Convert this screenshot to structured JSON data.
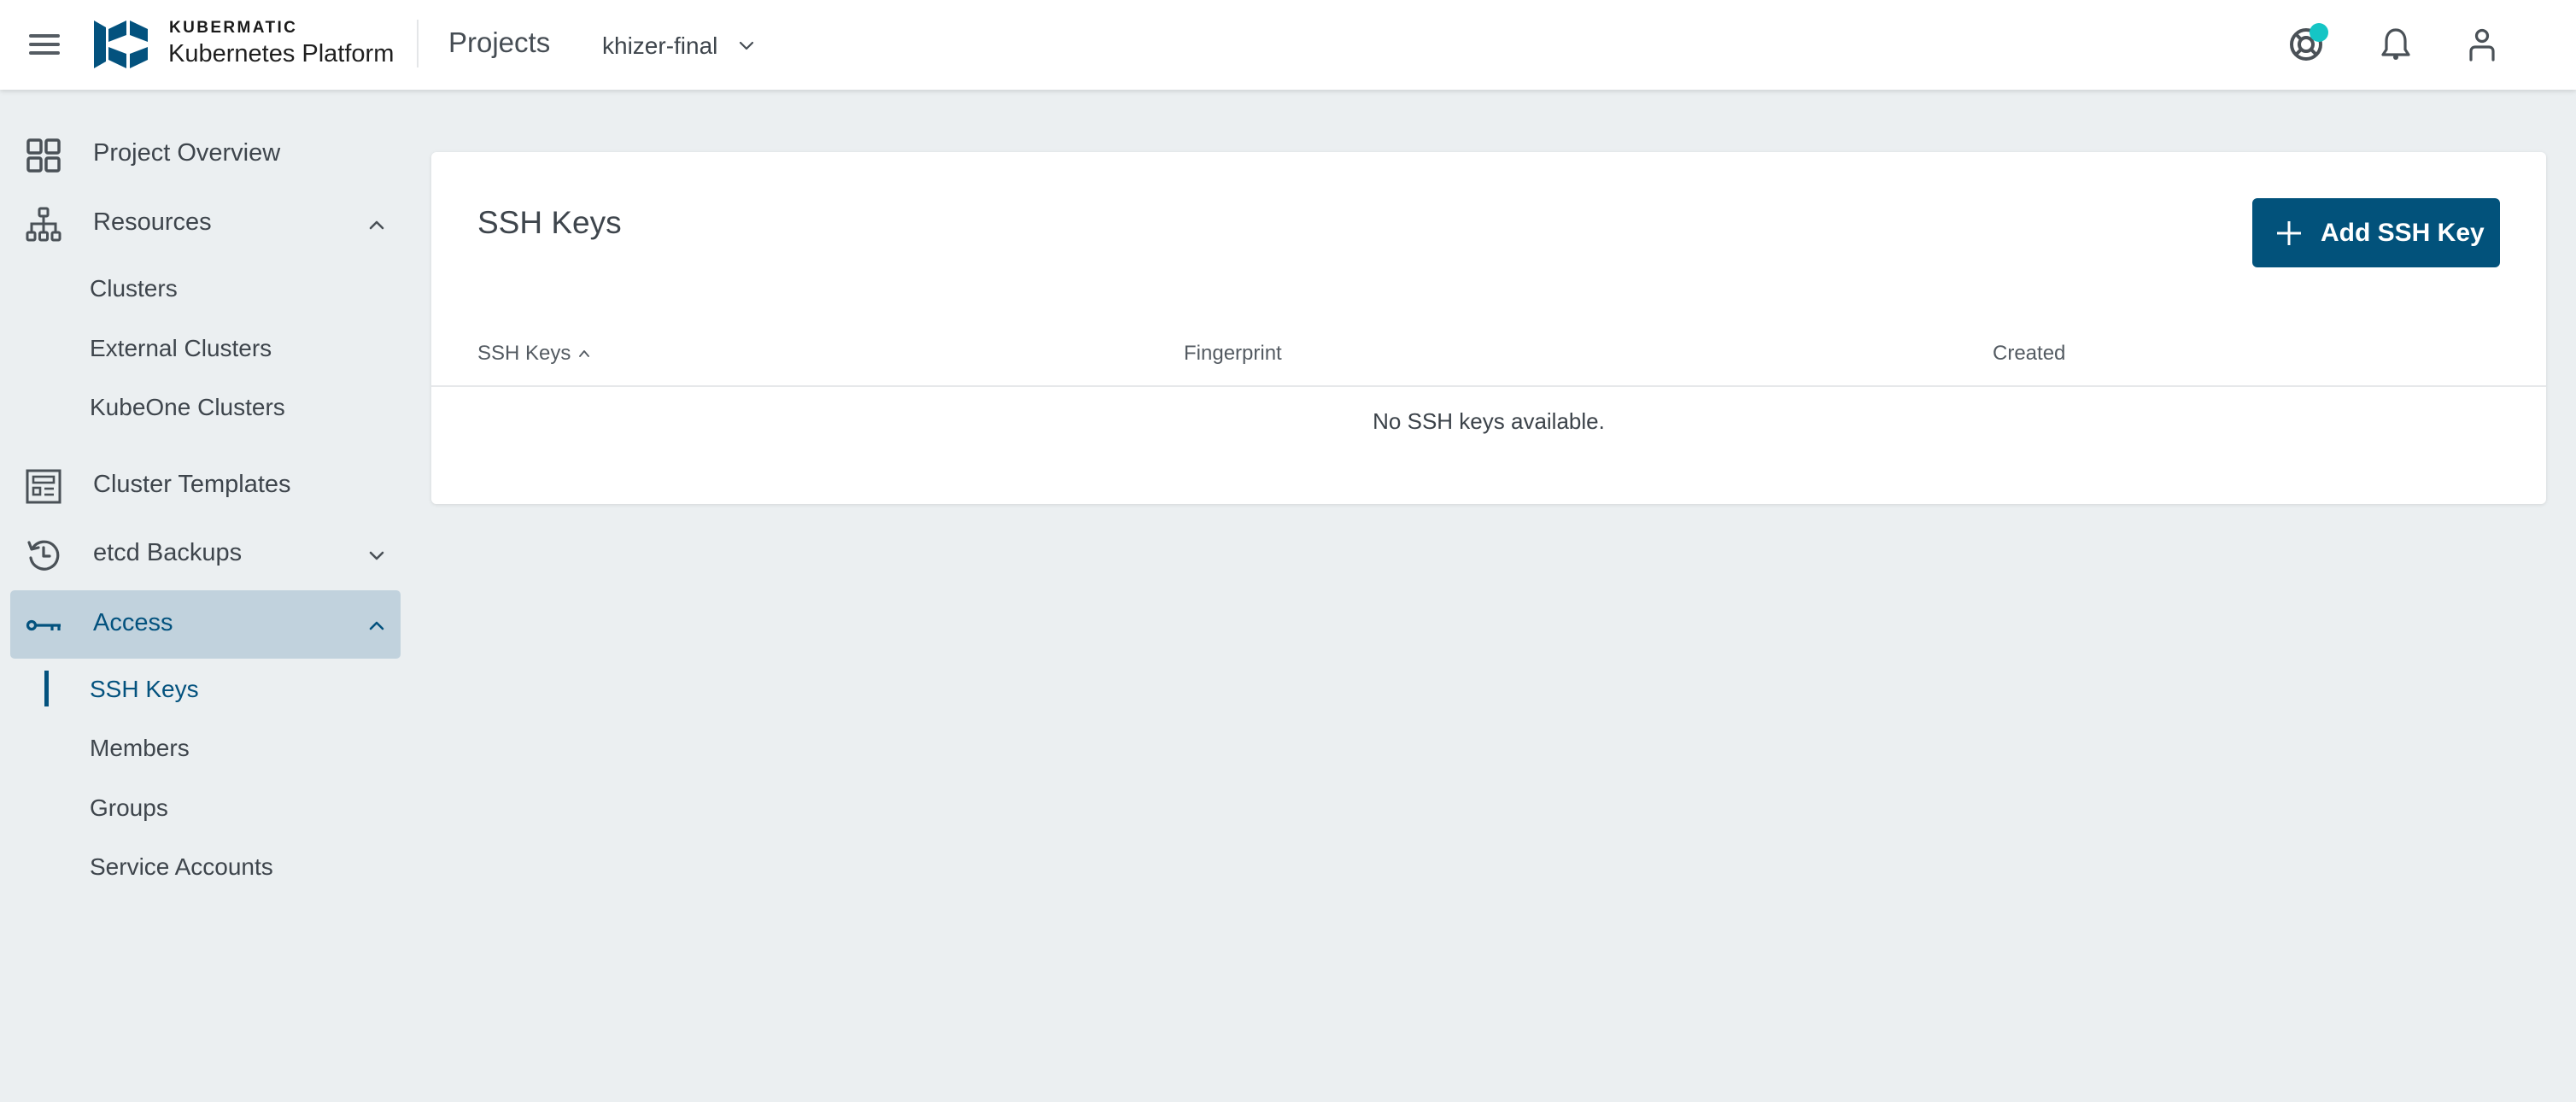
{
  "header": {
    "menu_icon": "hamburger-menu-icon",
    "brand_top": "KUBERMATIC",
    "brand_bottom": "Kubernetes Platform",
    "projects_link": "Projects",
    "project_selector": {
      "value": "khizer-final",
      "icon": "chevron-down-icon"
    },
    "icons": [
      "help-lifebuoy-icon",
      "bell-icon",
      "user-icon"
    ],
    "help_badge_color": "#15c5c5"
  },
  "sidebar": {
    "items": [
      {
        "label": "Project Overview",
        "icon": "grid-icon"
      },
      {
        "label": "Resources",
        "icon": "sitemap-icon",
        "expanded": true,
        "children": [
          "Clusters",
          "External Clusters",
          "KubeOne Clusters"
        ]
      },
      {
        "label": "Cluster Templates",
        "icon": "template-icon"
      },
      {
        "label": "etcd Backups",
        "icon": "history-icon",
        "expanded": false
      },
      {
        "label": "Access",
        "icon": "key-icon",
        "expanded": true,
        "active": true,
        "children": [
          "SSH Keys",
          "Members",
          "Groups",
          "Service Accounts"
        ],
        "active_child": "SSH Keys"
      }
    ]
  },
  "main": {
    "title": "SSH Keys",
    "add_button": "Add SSH Key",
    "table": {
      "columns": [
        "SSH Keys",
        "Fingerprint",
        "Created"
      ],
      "sorted_column": "SSH Keys",
      "sort_direction": "ascending",
      "rows": [],
      "empty_message": "No SSH keys available."
    }
  },
  "colors": {
    "primary": "#02527b",
    "active_bg": "#c1d2dd",
    "page_bg": "#ebeff1",
    "text": "#3e454c"
  }
}
